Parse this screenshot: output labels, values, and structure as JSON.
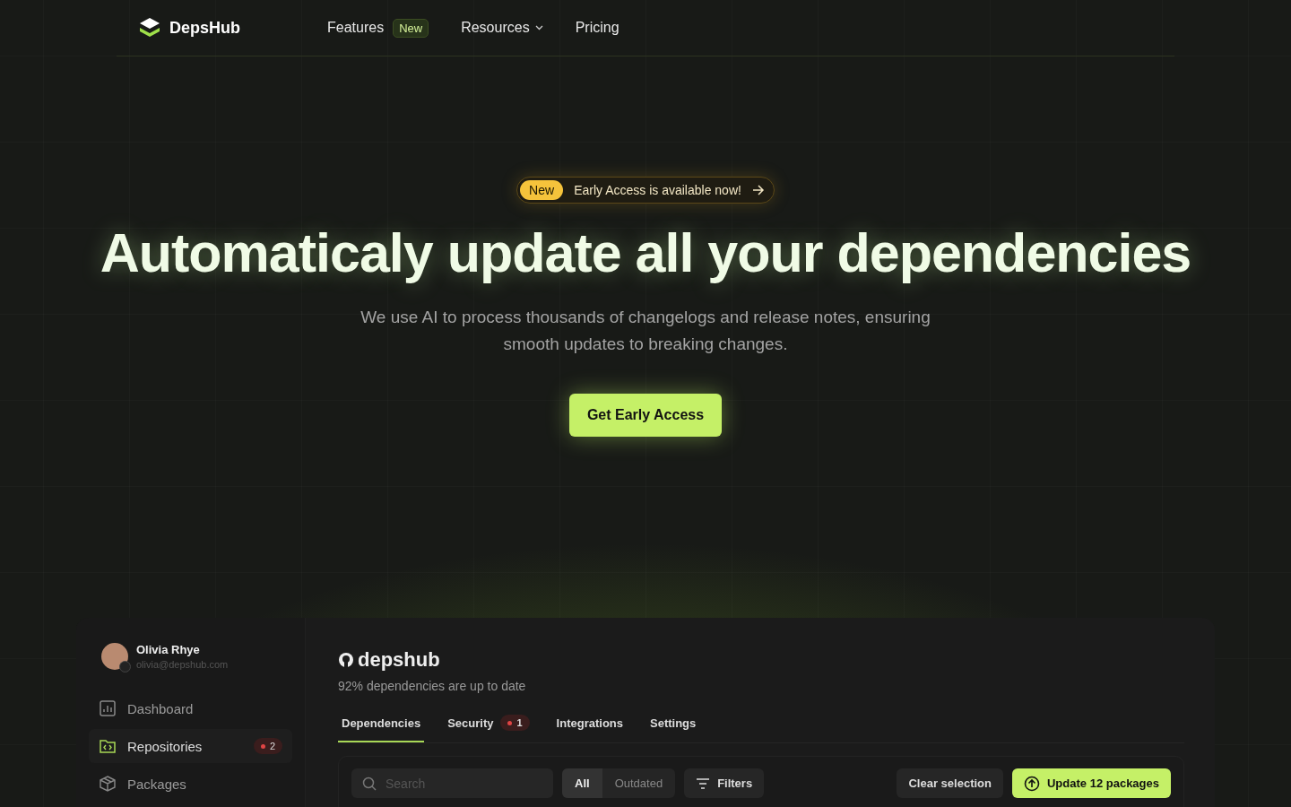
{
  "nav": {
    "brand": "DepsHub",
    "links": [
      {
        "label": "Features",
        "badge": "New",
        "kind": "badge"
      },
      {
        "label": "Resources",
        "kind": "dropdown"
      },
      {
        "label": "Pricing",
        "kind": "plain"
      }
    ]
  },
  "hero": {
    "announcement": {
      "tag": "New",
      "text": "Early Access is available now!"
    },
    "title": "Automaticaly update all your dependencies",
    "subtitle": "We use AI to process thousands of changelogs and release notes, ensuring smooth updates to breaking changes.",
    "cta": "Get Early Access"
  },
  "app": {
    "user": {
      "name": "Olivia Rhye",
      "email": "olivia@depshub.com"
    },
    "sidebar": {
      "items": [
        {
          "label": "Dashboard",
          "kind": "chart",
          "selected": false
        },
        {
          "label": "Repositories",
          "kind": "folder",
          "selected": true,
          "count": "2"
        },
        {
          "label": "Packages",
          "kind": "box",
          "selected": false
        }
      ]
    },
    "repo": {
      "name": "depshub",
      "subtitle": "92% dependencies are up to date"
    },
    "tabs": [
      {
        "label": "Dependencies",
        "selected": true
      },
      {
        "label": "Security",
        "selected": false,
        "count": "1"
      },
      {
        "label": "Integrations",
        "selected": false
      },
      {
        "label": "Settings",
        "selected": false
      }
    ],
    "toolbar": {
      "search": {
        "placeholder": "Search"
      },
      "segments": [
        {
          "label": "All",
          "selected": true
        },
        {
          "label": "Outdated",
          "selected": false
        }
      ],
      "filters": "Filters",
      "clear": "Clear selection",
      "update": "Update 12 packages"
    }
  }
}
